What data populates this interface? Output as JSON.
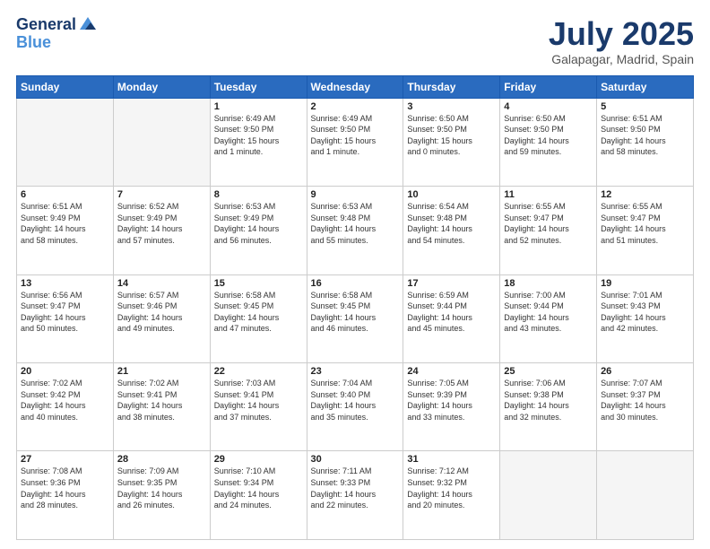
{
  "header": {
    "logo_line1": "General",
    "logo_line2": "Blue",
    "month": "July 2025",
    "location": "Galapagar, Madrid, Spain"
  },
  "weekdays": [
    "Sunday",
    "Monday",
    "Tuesday",
    "Wednesday",
    "Thursday",
    "Friday",
    "Saturday"
  ],
  "weeks": [
    [
      {
        "day": "",
        "info": ""
      },
      {
        "day": "",
        "info": ""
      },
      {
        "day": "1",
        "info": "Sunrise: 6:49 AM\nSunset: 9:50 PM\nDaylight: 15 hours\nand 1 minute."
      },
      {
        "day": "2",
        "info": "Sunrise: 6:49 AM\nSunset: 9:50 PM\nDaylight: 15 hours\nand 1 minute."
      },
      {
        "day": "3",
        "info": "Sunrise: 6:50 AM\nSunset: 9:50 PM\nDaylight: 15 hours\nand 0 minutes."
      },
      {
        "day": "4",
        "info": "Sunrise: 6:50 AM\nSunset: 9:50 PM\nDaylight: 14 hours\nand 59 minutes."
      },
      {
        "day": "5",
        "info": "Sunrise: 6:51 AM\nSunset: 9:50 PM\nDaylight: 14 hours\nand 58 minutes."
      }
    ],
    [
      {
        "day": "6",
        "info": "Sunrise: 6:51 AM\nSunset: 9:49 PM\nDaylight: 14 hours\nand 58 minutes."
      },
      {
        "day": "7",
        "info": "Sunrise: 6:52 AM\nSunset: 9:49 PM\nDaylight: 14 hours\nand 57 minutes."
      },
      {
        "day": "8",
        "info": "Sunrise: 6:53 AM\nSunset: 9:49 PM\nDaylight: 14 hours\nand 56 minutes."
      },
      {
        "day": "9",
        "info": "Sunrise: 6:53 AM\nSunset: 9:48 PM\nDaylight: 14 hours\nand 55 minutes."
      },
      {
        "day": "10",
        "info": "Sunrise: 6:54 AM\nSunset: 9:48 PM\nDaylight: 14 hours\nand 54 minutes."
      },
      {
        "day": "11",
        "info": "Sunrise: 6:55 AM\nSunset: 9:47 PM\nDaylight: 14 hours\nand 52 minutes."
      },
      {
        "day": "12",
        "info": "Sunrise: 6:55 AM\nSunset: 9:47 PM\nDaylight: 14 hours\nand 51 minutes."
      }
    ],
    [
      {
        "day": "13",
        "info": "Sunrise: 6:56 AM\nSunset: 9:47 PM\nDaylight: 14 hours\nand 50 minutes."
      },
      {
        "day": "14",
        "info": "Sunrise: 6:57 AM\nSunset: 9:46 PM\nDaylight: 14 hours\nand 49 minutes."
      },
      {
        "day": "15",
        "info": "Sunrise: 6:58 AM\nSunset: 9:45 PM\nDaylight: 14 hours\nand 47 minutes."
      },
      {
        "day": "16",
        "info": "Sunrise: 6:58 AM\nSunset: 9:45 PM\nDaylight: 14 hours\nand 46 minutes."
      },
      {
        "day": "17",
        "info": "Sunrise: 6:59 AM\nSunset: 9:44 PM\nDaylight: 14 hours\nand 45 minutes."
      },
      {
        "day": "18",
        "info": "Sunrise: 7:00 AM\nSunset: 9:44 PM\nDaylight: 14 hours\nand 43 minutes."
      },
      {
        "day": "19",
        "info": "Sunrise: 7:01 AM\nSunset: 9:43 PM\nDaylight: 14 hours\nand 42 minutes."
      }
    ],
    [
      {
        "day": "20",
        "info": "Sunrise: 7:02 AM\nSunset: 9:42 PM\nDaylight: 14 hours\nand 40 minutes."
      },
      {
        "day": "21",
        "info": "Sunrise: 7:02 AM\nSunset: 9:41 PM\nDaylight: 14 hours\nand 38 minutes."
      },
      {
        "day": "22",
        "info": "Sunrise: 7:03 AM\nSunset: 9:41 PM\nDaylight: 14 hours\nand 37 minutes."
      },
      {
        "day": "23",
        "info": "Sunrise: 7:04 AM\nSunset: 9:40 PM\nDaylight: 14 hours\nand 35 minutes."
      },
      {
        "day": "24",
        "info": "Sunrise: 7:05 AM\nSunset: 9:39 PM\nDaylight: 14 hours\nand 33 minutes."
      },
      {
        "day": "25",
        "info": "Sunrise: 7:06 AM\nSunset: 9:38 PM\nDaylight: 14 hours\nand 32 minutes."
      },
      {
        "day": "26",
        "info": "Sunrise: 7:07 AM\nSunset: 9:37 PM\nDaylight: 14 hours\nand 30 minutes."
      }
    ],
    [
      {
        "day": "27",
        "info": "Sunrise: 7:08 AM\nSunset: 9:36 PM\nDaylight: 14 hours\nand 28 minutes."
      },
      {
        "day": "28",
        "info": "Sunrise: 7:09 AM\nSunset: 9:35 PM\nDaylight: 14 hours\nand 26 minutes."
      },
      {
        "day": "29",
        "info": "Sunrise: 7:10 AM\nSunset: 9:34 PM\nDaylight: 14 hours\nand 24 minutes."
      },
      {
        "day": "30",
        "info": "Sunrise: 7:11 AM\nSunset: 9:33 PM\nDaylight: 14 hours\nand 22 minutes."
      },
      {
        "day": "31",
        "info": "Sunrise: 7:12 AM\nSunset: 9:32 PM\nDaylight: 14 hours\nand 20 minutes."
      },
      {
        "day": "",
        "info": ""
      },
      {
        "day": "",
        "info": ""
      }
    ]
  ]
}
